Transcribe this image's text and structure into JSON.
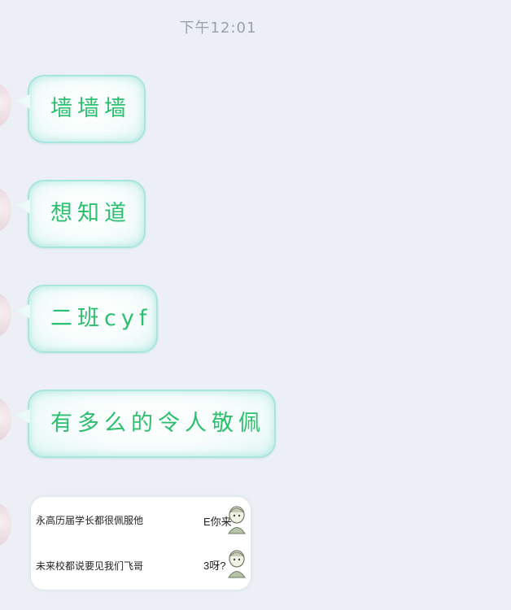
{
  "status": {
    "time": "下午12:01"
  },
  "messages": [
    {
      "text": "墙墙墙"
    },
    {
      "text": "想知道"
    },
    {
      "text": "二班cyf"
    },
    {
      "text": "有多么的令人敬佩"
    }
  ],
  "image_message": {
    "line1": "永高历届学长都很佩服他",
    "line1_tail": "E你来",
    "line2": "未来校都说要见我们飞哥",
    "line2_tail": "3呀?"
  }
}
